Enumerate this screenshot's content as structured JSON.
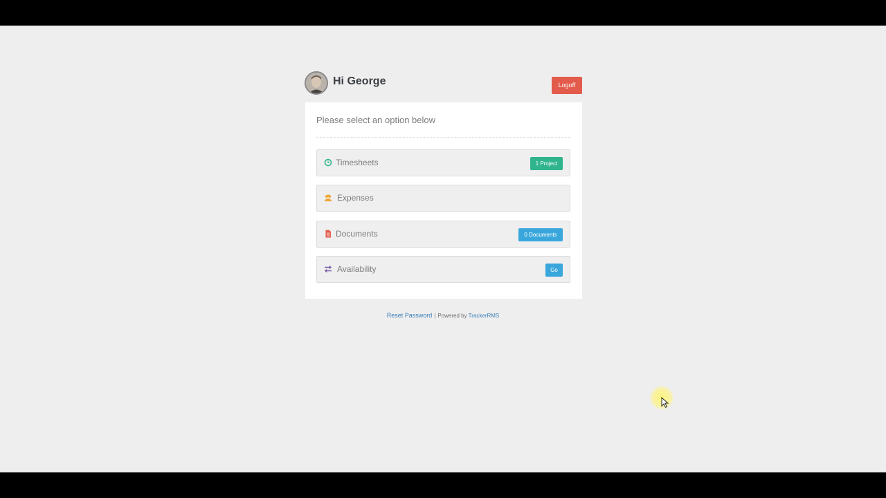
{
  "header": {
    "greeting": "Hi George",
    "logoff_label": "Logoff"
  },
  "panel": {
    "intro": "Please select an option below",
    "options": [
      {
        "label": "Timesheets",
        "icon": "clock-icon",
        "icon_color": "#2fb48d",
        "badge": "1 Project",
        "badge_color": "#2fb48d"
      },
      {
        "label": "Expenses",
        "icon": "users-icon",
        "icon_color": "#f0a430",
        "badge": null
      },
      {
        "label": "Documents",
        "icon": "document-icon",
        "icon_color": "#e35b4b",
        "badge": "0 Documents",
        "badge_color": "#3aa7dc"
      },
      {
        "label": "Availability",
        "icon": "exchange-icon",
        "icon_color": "#7b5ea7",
        "badge": "Go",
        "badge_color": "#3aa7dc"
      }
    ]
  },
  "footer": {
    "reset_password": "Reset Password",
    "separator": "|",
    "powered_by": "Powered by",
    "brand": "TrackerRMS"
  },
  "colors": {
    "background": "#eeeeee",
    "logoff": "#e35b4b",
    "link": "#3a7fb8"
  }
}
